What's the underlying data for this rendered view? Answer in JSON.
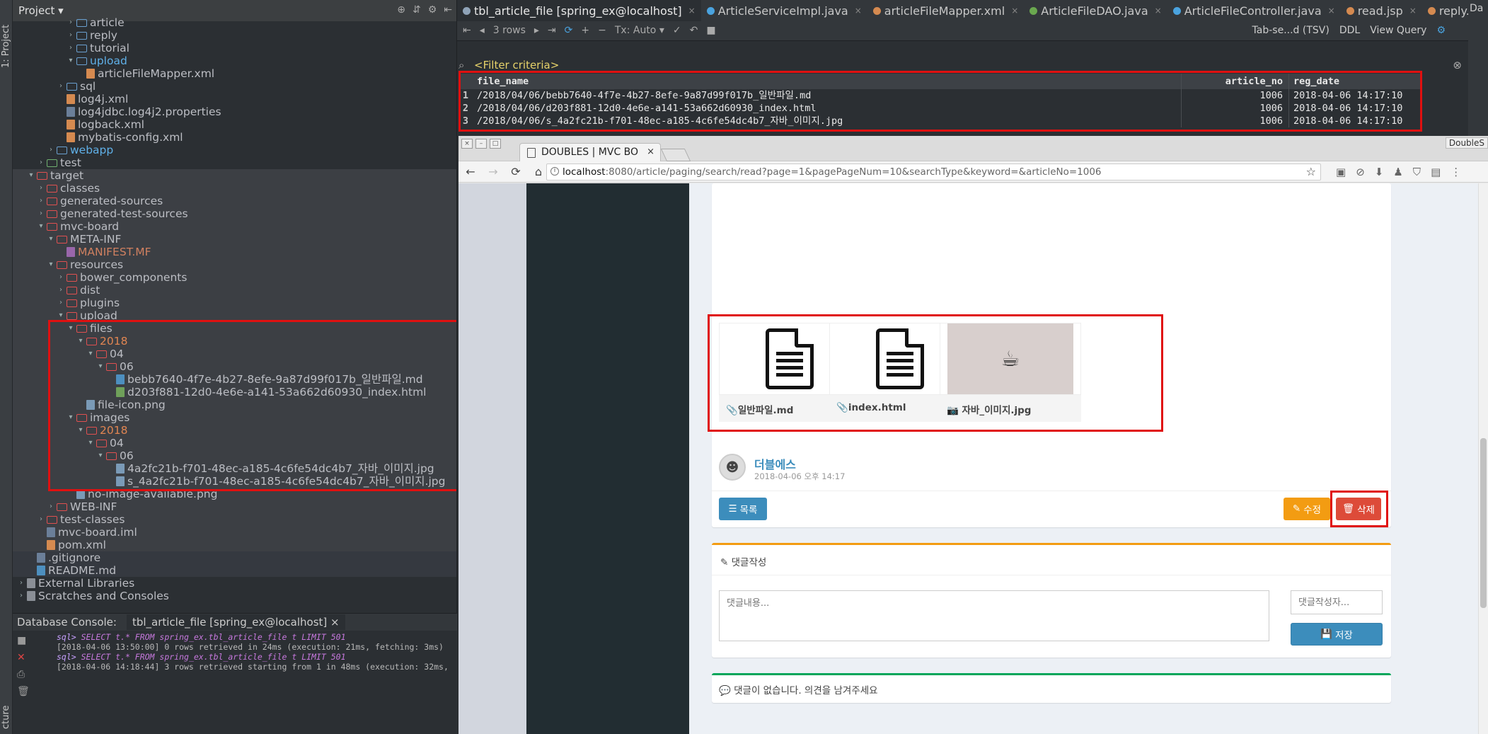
{
  "ide": {
    "project_label": "Project",
    "side_tab_project": "1: Project",
    "side_tab_structure": "cture",
    "right_strip_label": "Da"
  },
  "tree": [
    {
      "name": "article",
      "type": "folder",
      "indent": 5
    },
    {
      "name": "reply",
      "type": "folder",
      "indent": 5
    },
    {
      "name": "tutorial",
      "type": "folder",
      "indent": 5
    },
    {
      "name": "upload",
      "type": "folder",
      "indent": 5,
      "open": true,
      "color": "blue"
    },
    {
      "name": "articleFileMapper.xml",
      "type": "xml",
      "indent": 6
    },
    {
      "name": "sql",
      "type": "folder",
      "indent": 4
    },
    {
      "name": "log4j.xml",
      "type": "xml",
      "indent": 4
    },
    {
      "name": "log4jdbc.log4j2.properties",
      "type": "file",
      "indent": 4
    },
    {
      "name": "logback.xml",
      "type": "xml",
      "indent": 4
    },
    {
      "name": "mybatis-config.xml",
      "type": "xml",
      "indent": 4
    },
    {
      "name": "webapp",
      "type": "folder",
      "indent": 3,
      "color": "blue"
    },
    {
      "name": "test",
      "type": "folder-green",
      "indent": 2
    },
    {
      "name": "target",
      "type": "folder-red",
      "indent": 1,
      "open": true,
      "sel": true
    },
    {
      "name": "classes",
      "type": "folder-red",
      "indent": 2,
      "sel": true
    },
    {
      "name": "generated-sources",
      "type": "folder-red",
      "indent": 2,
      "sel": true
    },
    {
      "name": "generated-test-sources",
      "type": "folder-red",
      "indent": 2,
      "sel": true
    },
    {
      "name": "mvc-board",
      "type": "folder-red",
      "indent": 2,
      "open": true,
      "sel": true
    },
    {
      "name": "META-INF",
      "type": "folder-red",
      "indent": 3,
      "open": true,
      "sel": true
    },
    {
      "name": "MANIFEST.MF",
      "type": "mf",
      "indent": 4,
      "color": "red",
      "sel": true
    },
    {
      "name": "resources",
      "type": "folder-red",
      "indent": 3,
      "open": true,
      "sel": true
    },
    {
      "name": "bower_components",
      "type": "folder-red",
      "indent": 4,
      "sel": true
    },
    {
      "name": "dist",
      "type": "folder-red",
      "indent": 4,
      "sel": true
    },
    {
      "name": "plugins",
      "type": "folder-red",
      "indent": 4,
      "sel": true
    },
    {
      "name": "upload",
      "type": "folder-red",
      "indent": 4,
      "open": true,
      "sel": true
    },
    {
      "name": "files",
      "type": "folder-red",
      "indent": 5,
      "open": true,
      "sel": true
    },
    {
      "name": "2018",
      "type": "folder-red",
      "indent": 6,
      "open": true,
      "color": "orange",
      "sel": true
    },
    {
      "name": "04",
      "type": "folder-red",
      "indent": 7,
      "open": true,
      "sel": true
    },
    {
      "name": "06",
      "type": "folder-red",
      "indent": 8,
      "open": true,
      "sel": true
    },
    {
      "name": "bebb7640-4f7e-4b27-8efe-9a87d99f017b_일반파일.md",
      "type": "md",
      "indent": 9,
      "sel": true
    },
    {
      "name": "d203f881-12d0-4e6e-a141-53a662d60930_index.html",
      "type": "html",
      "indent": 9,
      "sel": true
    },
    {
      "name": "file-icon.png",
      "type": "png",
      "indent": 6,
      "sel": true
    },
    {
      "name": "images",
      "type": "folder-red",
      "indent": 5,
      "open": true,
      "sel": true
    },
    {
      "name": "2018",
      "type": "folder-red",
      "indent": 6,
      "open": true,
      "color": "orange",
      "sel": true
    },
    {
      "name": "04",
      "type": "folder-red",
      "indent": 7,
      "open": true,
      "sel": true
    },
    {
      "name": "06",
      "type": "folder-red",
      "indent": 8,
      "open": true,
      "sel": true
    },
    {
      "name": "4a2fc21b-f701-48ec-a185-4c6fe54dc4b7_자바_이미지.jpg",
      "type": "png",
      "indent": 9,
      "sel": true
    },
    {
      "name": "s_4a2fc21b-f701-48ec-a185-4c6fe54dc4b7_자바_이미지.jpg",
      "type": "png",
      "indent": 9,
      "sel": true
    },
    {
      "name": "no-image-available.png",
      "type": "png",
      "indent": 5,
      "sel": true
    },
    {
      "name": "WEB-INF",
      "type": "folder-red",
      "indent": 3,
      "sel": true
    },
    {
      "name": "test-classes",
      "type": "folder-red",
      "indent": 2,
      "sel": true
    },
    {
      "name": "mvc-board.iml",
      "type": "file",
      "indent": 2,
      "sel": true
    },
    {
      "name": "pom.xml",
      "type": "xml",
      "indent": 2,
      "sel": true
    },
    {
      "name": ".gitignore",
      "type": "file",
      "indent": 1,
      "sel2": true
    },
    {
      "name": "README.md",
      "type": "md",
      "indent": 1,
      "sel2": true
    },
    {
      "name": "External Libraries",
      "type": "lib",
      "indent": 0
    },
    {
      "name": "Scratches and Consoles",
      "type": "lib",
      "indent": 0
    }
  ],
  "console": {
    "label": "Database Console:",
    "tab": "tbl_article_file [spring_ex@localhost]",
    "lines": [
      {
        "prefix": "sql>",
        "text": " SELECT t.* FROM spring_ex.tbl_article_file t LIMIT 501",
        "kind": "sql"
      },
      {
        "prefix": "",
        "text": "[2018-04-06 13:50:00] 0 rows retrieved in 24ms (execution: 21ms, fetching: 3ms)",
        "kind": "log"
      },
      {
        "prefix": "sql>",
        "text": " SELECT t.* FROM spring_ex.tbl_article_file t LIMIT 501",
        "kind": "sql"
      },
      {
        "prefix": "",
        "text": "[2018-04-06 14:18:44] 3 rows retrieved starting from 1 in 48ms (execution: 32ms,",
        "kind": "log"
      }
    ]
  },
  "editor_tabs": [
    {
      "label": "tbl_article_file [spring_ex@localhost]",
      "color": "#8fa3b8",
      "active": true
    },
    {
      "label": "ArticleServiceImpl.java",
      "color": "#4aa3df"
    },
    {
      "label": "articleFileMapper.xml",
      "color": "#d58a50"
    },
    {
      "label": "ArticleFileDAO.java",
      "color": "#6aa84f"
    },
    {
      "label": "ArticleFileController.java",
      "color": "#4aa3df"
    },
    {
      "label": "read.jsp",
      "color": "#d58a50"
    },
    {
      "label": "reply.js",
      "color": "#d58a50"
    }
  ],
  "toolbar": {
    "rows": "3 rows",
    "tx": "Tx: Auto",
    "export": "Tab-se...d (TSV)",
    "ddl": "DDL",
    "view_query": "View Query"
  },
  "filter": "<Filter criteria>",
  "grid": {
    "headers": [
      "file_name",
      "article_no",
      "reg_date"
    ],
    "rows": [
      [
        "1",
        "/2018/04/06/bebb7640-4f7e-4b27-8efe-9a87d99f017b_일반파일.md",
        "1006",
        "2018-04-06 14:17:10"
      ],
      [
        "2",
        "/2018/04/06/d203f881-12d0-4e6e-a141-53a662d60930_index.html",
        "1006",
        "2018-04-06 14:17:10"
      ],
      [
        "3",
        "/2018/04/06/s_4a2fc21b-f701-48ec-a185-4c6fe54dc4b7_자바_이미지.jpg",
        "1006",
        "2018-04-06 14:17:10"
      ]
    ]
  },
  "browser": {
    "tab_title": "DOUBLES | MVC BO",
    "profile": "DoubleS",
    "url_host": "localhost",
    "url_rest": ":8080/article/paging/search/read?page=1&pagePageNum=10&searchType&keyword=&articleNo=1006"
  },
  "article": {
    "attachments": [
      {
        "name": "일반파일.md",
        "kind": "doc",
        "icon": "paperclip-icon"
      },
      {
        "name": "index.html",
        "kind": "doc",
        "icon": "paperclip-icon"
      },
      {
        "name": "자바_이미지.jpg",
        "kind": "image",
        "icon": "camera-icon"
      }
    ],
    "author": "더블에스",
    "date": "2018-04-06 오후 14:17",
    "btn_list": "목록",
    "btn_edit": "수정",
    "btn_delete": "삭제"
  },
  "reply": {
    "title": "댓글작성",
    "content_placeholder": "댓글내용...",
    "writer_placeholder": "댓글작성자...",
    "save": "저장",
    "empty": "댓글이 없습니다. 의견을 남겨주세요"
  },
  "colors": {
    "highlight": "#e01010",
    "primary": "#3c8dbc",
    "warning": "#f39c12",
    "danger": "#dd4b39",
    "success": "#00a65a"
  }
}
